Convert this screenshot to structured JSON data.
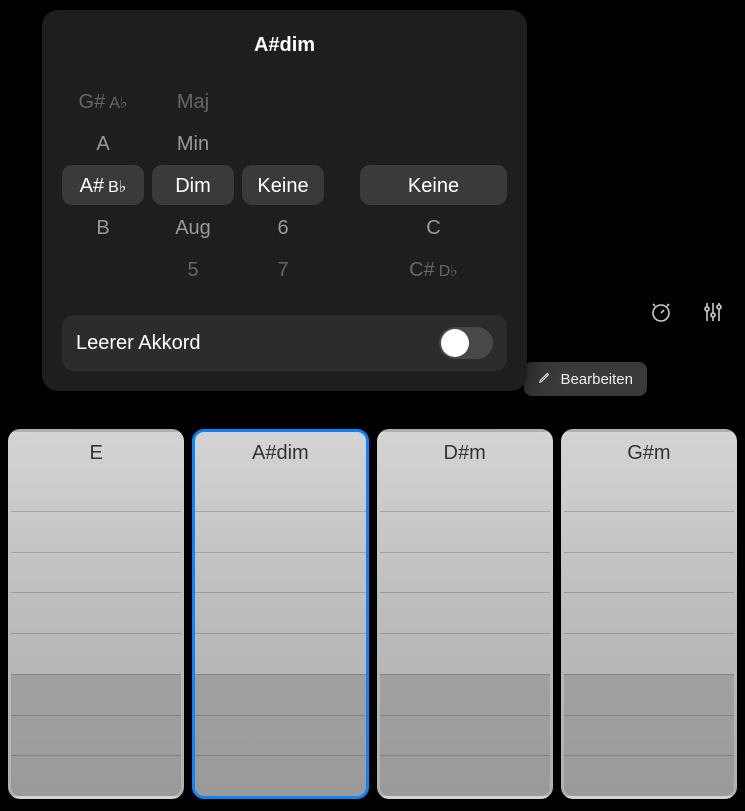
{
  "popover": {
    "title": "A#dim",
    "root": {
      "items": [
        "G#",
        "A",
        "A#",
        "B",
        ""
      ],
      "enharmonic": {
        "0": "A♭",
        "2": "B♭"
      },
      "selectedIndex": 2
    },
    "quality": {
      "items": [
        "Maj",
        "Min",
        "Dim",
        "Aug",
        "5"
      ],
      "selectedIndex": 2
    },
    "extension": {
      "items": [
        "",
        "",
        "Keine",
        "6",
        "7"
      ],
      "selectedIndex": 2
    },
    "bass": {
      "items": [
        "",
        "",
        "Keine",
        "C",
        "C#"
      ],
      "enharmonic": {
        "4": "D♭"
      },
      "selectedIndex": 2
    },
    "emptyChord": {
      "label": "Leerer Akkord",
      "value": false
    }
  },
  "toolbar": {
    "editLabel": "Bearbeiten"
  },
  "chords": [
    {
      "label": "E",
      "selected": false
    },
    {
      "label": "A#dim",
      "selected": true
    },
    {
      "label": "D#m",
      "selected": false
    },
    {
      "label": "G#m",
      "selected": false
    }
  ]
}
